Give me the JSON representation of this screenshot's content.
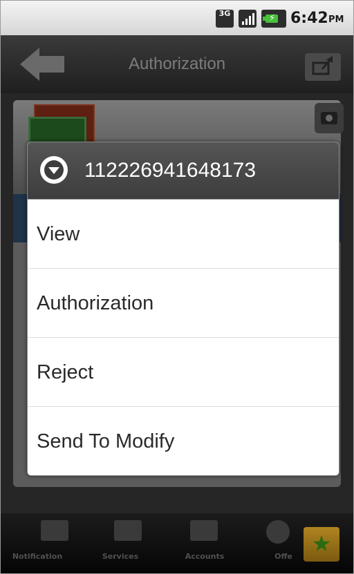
{
  "status_bar": {
    "network_label": "3G",
    "time": "6:42",
    "ampm": "PM",
    "icons": [
      "network-3g-icon",
      "signal-icon",
      "battery-charging-icon"
    ]
  },
  "title_bar": {
    "title": "Authorization",
    "back_icon": "back-arrow-icon",
    "share_icon": "share-icon"
  },
  "dialog": {
    "icon": "chevron-down-circle-icon",
    "title": "112226941648173",
    "items": [
      {
        "label": "View"
      },
      {
        "label": "Authorization"
      },
      {
        "label": "Reject"
      },
      {
        "label": "Send To Modify"
      }
    ]
  },
  "tab_bar": {
    "tabs": [
      {
        "label": "Notification",
        "icon": "notification-icon"
      },
      {
        "label": "Services",
        "icon": "wallet-icon"
      },
      {
        "label": "Accounts",
        "icon": "card-icon"
      },
      {
        "label": "Offe",
        "icon": "gear-icon"
      }
    ],
    "favorite_icon": "star-icon"
  },
  "colors": {
    "accent_green": "#47c13a",
    "dialog_header": "#4a4a4a",
    "favorite_gold": "#b08420"
  }
}
